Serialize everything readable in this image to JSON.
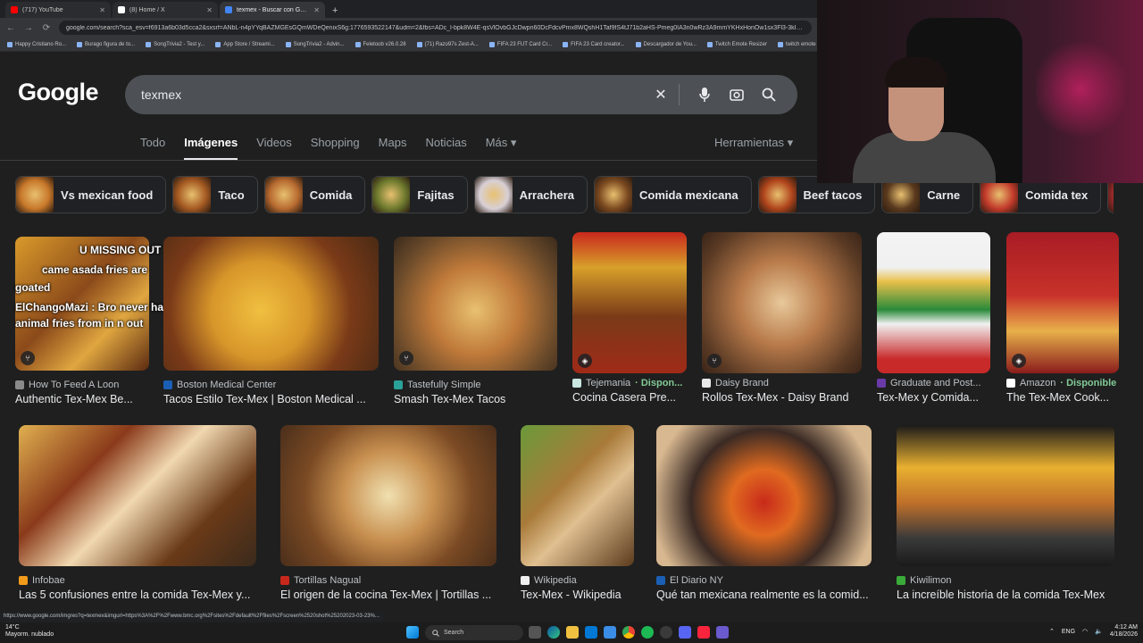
{
  "browser": {
    "tabs": [
      {
        "label": "(717) YouTube",
        "color": "#ff0000"
      },
      {
        "label": "(8) Home / X",
        "color": "#ffffff"
      },
      {
        "label": "texmex - Buscar con Google",
        "color": "#4285f4"
      }
    ],
    "url": "google.com/search?sca_esv=f6913a6b03d5cca2&sxsrf=ANbL-n4pYYqBAZMGEsGQmWDeQenixS6g:1776593522147&udm=2&fbs=ADc_l-bpk8W4E-qsVlOvbGJcDwpn60DcFdcvPmx8WQshH1Taf9fS4tJ71b2aHS-Pmeg0IA3n0wRz3A9mmYKHxHonOw1sx3Fl3-3kI2tc1aA-x0w",
    "bookmarks": [
      "Happy Cristiano Ro...",
      "Burago figura de to...",
      "SongTrivia2 - Test y...",
      "App Store / Streami...",
      "SongTrivia2 - Advin...",
      "Feletoob v26.0.28",
      "(71) Razo97s Zest-A...",
      "FIFA 23 FUT Card Cr...",
      "FIFA 23 Card creator...",
      "Descargador de You...",
      "Twitch Emote Resizer",
      "twitch emote re..."
    ]
  },
  "google": {
    "logo": "Google",
    "query": "texmex",
    "nav_tabs": [
      "Todo",
      "Imágenes",
      "Videos",
      "Shopping",
      "Maps",
      "Noticias",
      "Más ▾"
    ],
    "tools": "Herramientas ▾",
    "chips": [
      {
        "label": "Vs mexican food",
        "color": "#c8782a"
      },
      {
        "label": "Taco",
        "color": "#a55a22"
      },
      {
        "label": "Comida",
        "color": "#b86b30"
      },
      {
        "label": "Fajitas",
        "color": "#6e7a2e"
      },
      {
        "label": "Arrachera",
        "color": "#d8d0d6"
      },
      {
        "label": "Comida mexicana",
        "color": "#7c4a20"
      },
      {
        "label": "Beef tacos",
        "color": "#b0451c"
      },
      {
        "label": "Carne",
        "color": "#5a3a1e"
      },
      {
        "label": "Comida tex",
        "color": "#c23a2a"
      },
      {
        "label": "",
        "color": "#9a2a2a"
      }
    ]
  },
  "results_row1": [
    {
      "source": "How To Feed A Loon",
      "title": "Authentic Tex-Mex Be...",
      "icon_color": "#8a8a8a",
      "img": "linear-gradient(135deg,#d99a2b 0%,#8b4a1a 45%,#e0a640 70%,#5a2a10 100%)",
      "badge": "🍴",
      "available": ""
    },
    {
      "source": "Boston Medical Center",
      "title": "Tacos Estilo Tex-Mex | Boston Medical ...",
      "icon_color": "#1a5fb4",
      "img": "radial-gradient(circle at 45% 55%,#f0c040 0%,#d8962a 35%,#7a3a18 65%,#4a2a14 100%)",
      "badge": "",
      "available": ""
    },
    {
      "source": "Tastefully Simple",
      "title": "Smash Tex-Mex Tacos",
      "icon_color": "#2aa198",
      "img": "radial-gradient(circle at 50% 55%,#e8c070 0%,#c07a3a 40%,#6a4a2a 75%,#3a2a1c 100%)",
      "badge": "🍴",
      "available": ""
    },
    {
      "source": "Tejemania",
      "title": "Cocina Casera Pre...",
      "icon_color": "#c9e6e0",
      "img": "linear-gradient(180deg,#c8281c 0%,#d8a02a 25%,#7a3a18 60%,#a02a18 100%)",
      "badge": "🏷",
      "available": "· Dispon..."
    },
    {
      "source": "Daisy Brand",
      "title": "Rollos Tex-Mex - Daisy Brand",
      "icon_color": "#e8e8e8",
      "img": "radial-gradient(circle at 50% 50%,#e8c89a 0%,#b87a4a 40%,#5a3a24 80%,#3a2418 100%)",
      "badge": "🍴",
      "available": ""
    },
    {
      "source": "Graduate and Post...",
      "title": "Tex-Mex y Comida...",
      "icon_color": "#6a3aa8",
      "img": "linear-gradient(180deg,#f4f4f4 0%,#f0f0f0 25%,#e8c04a 35%,#2a8a3a 55%,#f0f0f0 65%,#c82a2a 90%)",
      "badge": "",
      "available": ""
    },
    {
      "source": "Amazon",
      "title": "The Tex-Mex Cook...",
      "icon_color": "#ffffff",
      "img": "linear-gradient(180deg,#a81c24 0%,#c8322a 45%,#e8b04a 70%,#8a1c1c 100%)",
      "badge": "🏷",
      "available": "· Disponible"
    }
  ],
  "results_row2": [
    {
      "source": "Infobae",
      "title": "Las 5 confusiones entre la comida Tex-Mex y...",
      "icon_color": "#f29a1a",
      "img": "linear-gradient(135deg,#e0b050 0%,#8a3a1a 30%,#f0d8b0 50%,#6a3a18 75%,#3a2a1c 100%)"
    },
    {
      "source": "Tortillas Nagual",
      "title": "El origen de la cocina Tex-Mex | Tortillas ...",
      "icon_color": "#c8281c",
      "img": "radial-gradient(circle at 50% 50%,#f0e0b0 0%,#c89050 35%,#7a4a24 65%,#4a2e1a 100%)"
    },
    {
      "source": "Wikipedia",
      "title": "Tex-Mex - Wikipedia",
      "icon_color": "#f0f0f0",
      "img": "linear-gradient(135deg,#6a9a3a 0%,#a87a3a 40%,#e0c090 60%,#5a3a1c 100%)"
    },
    {
      "source": "El Diario NY",
      "title": "Qué tan mexicana realmente es la comid...",
      "icon_color": "#1a5fb4",
      "img": "radial-gradient(circle at 50% 55%,#c82a1a 0%,#e06a20 25%,#3a2a24 55%,#d8b890 85%)"
    },
    {
      "source": "Kiwilimon",
      "title": "La increíble historia de la comida Tex-Mex",
      "icon_color": "#3aaa3a",
      "img": "linear-gradient(180deg,#1a1a1a 0%,#e8b030 30%,#c0702a 55%,#3a3a3a 80%,#1a1a1a 100%)"
    }
  ],
  "overlay_chat": [
    "U MISSING OUT",
    "came asada fries are",
    "goated",
    "ElChangoMazi : Bro never had",
    "animal fries from in n out"
  ],
  "status_url": "https://www.google.com/imgres?q=texmex&imgurl=https%3A%2F%2Fwww.bmc.org%2Fsites%2Fdefault%2Ffiles%2Fscreen%2520shot%25202023-03-23%...",
  "taskbar": {
    "temp": "14°C",
    "weather": "Mayorm. nublado",
    "search": "Search",
    "lang": "ENG",
    "time": "4:12 AM",
    "date": "4/18/2026"
  }
}
